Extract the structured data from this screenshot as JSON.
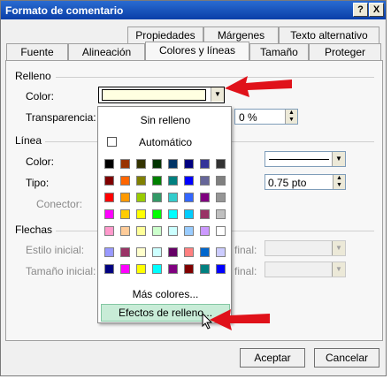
{
  "window": {
    "title": "Formato de comentario",
    "help_label": "?",
    "close_label": "X"
  },
  "tabs_row1": [
    {
      "label": "Propiedades"
    },
    {
      "label": "Márgenes"
    },
    {
      "label": "Texto alternativo"
    }
  ],
  "tabs_row2": [
    {
      "label": "Fuente"
    },
    {
      "label": "Alineación"
    },
    {
      "label": "Colores y líneas"
    },
    {
      "label": "Tamaño"
    },
    {
      "label": "Proteger"
    }
  ],
  "fill": {
    "title": "Relleno",
    "color_label": "Color:",
    "color_value": "#ffffe1",
    "transparency_label": "Transparencia:",
    "transparency_value": "0 %"
  },
  "line": {
    "title": "Línea",
    "color_label": "Color:",
    "type_label": "Tipo:",
    "weight_value": "0.75 pto",
    "connector_label": "Conector:"
  },
  "arrows": {
    "title": "Flechas",
    "start_style_label": "Estilo inicial:",
    "start_size_label": "Tamaño inicial:",
    "end_style_label": "final:",
    "end_size_label": "final:"
  },
  "palette": {
    "no_fill": "Sin relleno",
    "automatic": "Automático",
    "more_colors": "Más colores...",
    "fill_effects": "Efectos de relleno...",
    "rows": [
      [
        "#000000",
        "#993300",
        "#333300",
        "#003300",
        "#003366",
        "#000080",
        "#333399",
        "#333333"
      ],
      [
        "#800000",
        "#ff6600",
        "#808000",
        "#008000",
        "#008080",
        "#0000ff",
        "#666699",
        "#808080"
      ],
      [
        "#ff0000",
        "#ff9900",
        "#99cc00",
        "#339966",
        "#33cccc",
        "#3366ff",
        "#800080",
        "#969696"
      ],
      [
        "#ff00ff",
        "#ffcc00",
        "#ffff00",
        "#00ff00",
        "#00ffff",
        "#00ccff",
        "#993366",
        "#c0c0c0"
      ],
      [
        "#ff99cc",
        "#ffcc99",
        "#ffff99",
        "#ccffcc",
        "#ccffff",
        "#99ccff",
        "#cc99ff",
        "#ffffff"
      ]
    ],
    "rows_extra": [
      [
        "#9999ff",
        "#993366",
        "#ffffcc",
        "#ccffff",
        "#660066",
        "#ff8080",
        "#0066cc",
        "#ccccff"
      ],
      [
        "#000080",
        "#ff00ff",
        "#ffff00",
        "#00ffff",
        "#800080",
        "#800000",
        "#008080",
        "#0000ff"
      ]
    ]
  },
  "buttons": {
    "ok": "Aceptar",
    "cancel": "Cancelar"
  },
  "annotation_color": "#e0121a"
}
